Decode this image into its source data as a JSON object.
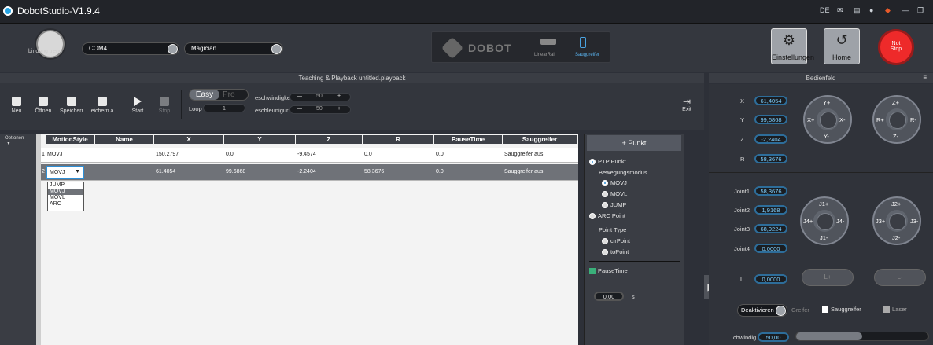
{
  "window": {
    "title": "DobotStudio-V1.9.4",
    "lang": "DE"
  },
  "toolbar": {
    "connect_label": "bindung trenn",
    "port": "COM4",
    "device": "Magician",
    "brand": "DOBOT",
    "linear_rail": "LinearRail",
    "end_effector": "Sauggreifer",
    "settings_label": "Einstellungen",
    "home_label": "Home",
    "stop_line1": "Not",
    "stop_line2": "Stop"
  },
  "playback": {
    "header": "Teaching & Playback  untitled.playback",
    "buttons": [
      "Neu",
      "Öffnen",
      "Speicherr",
      "eichern a",
      "Start",
      "Stop"
    ],
    "mode_easy": "Easy",
    "mode_pro": "Pro",
    "loop_label": "Loop",
    "loop_value": "1",
    "speed_label": "eschwindigke",
    "speed_value": "50",
    "accel_label": "eschleunigur",
    "accel_value": "50",
    "minus": "—",
    "plus": "+",
    "exit_label": "Exit",
    "options_label": "Optionen"
  },
  "table": {
    "headers": [
      "MotionStyle",
      "Name",
      "X",
      "Y",
      "Z",
      "R",
      "PauseTime",
      "Sauggreifer"
    ],
    "rows": [
      {
        "idx": "1",
        "style": "MOVJ",
        "name": "",
        "x": "150.2797",
        "y": "0.0",
        "z": "-9.4574",
        "r": "0.0",
        "pause": "0.0",
        "grip": "Sauggreifer aus"
      },
      {
        "idx": "2",
        "style": "MOVJ",
        "name": "",
        "x": "61.4054",
        "y": "99.6868",
        "z": "-2.2404",
        "r": "58.3676",
        "pause": "0.0",
        "grip": "Sauggreifer aus"
      }
    ],
    "dropdown": [
      "JUMP",
      "MOVJ",
      "MOVL",
      "ARC"
    ]
  },
  "ptp": {
    "add_point": "+ Punkt",
    "ptp_label": "PTP Punkt",
    "move_mode": "Bewegungsmodus",
    "modes": [
      "MOVJ",
      "MOVL",
      "JUMP"
    ],
    "arc_label": "ARC Point",
    "point_type": "Point Type",
    "point_types": [
      "cirPoint",
      "toPoint"
    ],
    "pause_label": "PauseTime",
    "pause_value": "0,00",
    "pause_unit": "s"
  },
  "bedienfeld": {
    "title": "Bedienfeld",
    "coords": [
      {
        "k": "X",
        "v": "61,4054"
      },
      {
        "k": "Y",
        "v": "99,6868"
      },
      {
        "k": "Z",
        "v": "-2,2404"
      },
      {
        "k": "R",
        "v": "58,3676"
      }
    ],
    "joints": [
      {
        "k": "Joint1",
        "v": "58,3676"
      },
      {
        "k": "Joint2",
        "v": "1,9168"
      },
      {
        "k": "Joint3",
        "v": "68,9224"
      },
      {
        "k": "Joint4",
        "v": "0,0000"
      }
    ],
    "l_label": "L",
    "l_value": "0,0000",
    "l_plus": "L+",
    "l_minus": "L-",
    "jog_xy": {
      "up": "Y+",
      "down": "Y-",
      "left": "X+",
      "right": "X-"
    },
    "jog_zr": {
      "up": "Z+",
      "down": "Z-",
      "left": "R+",
      "right": "R-"
    },
    "jog_j1": {
      "up": "J1+",
      "down": "J1-",
      "left": "J4+",
      "right": "J4-"
    },
    "jog_j2": {
      "up": "J2+",
      "down": "J2-",
      "left": "J3+",
      "right": "J3-"
    },
    "deactivate": "Deaktivieren",
    "gripper": "Greifer",
    "suction": "Sauggreifer",
    "laser": "Laser",
    "speed_label": "chwindig",
    "speed_value": "50,00"
  },
  "colors": {
    "accent": "#2e8fd6",
    "stop": "#ee2a2a"
  }
}
